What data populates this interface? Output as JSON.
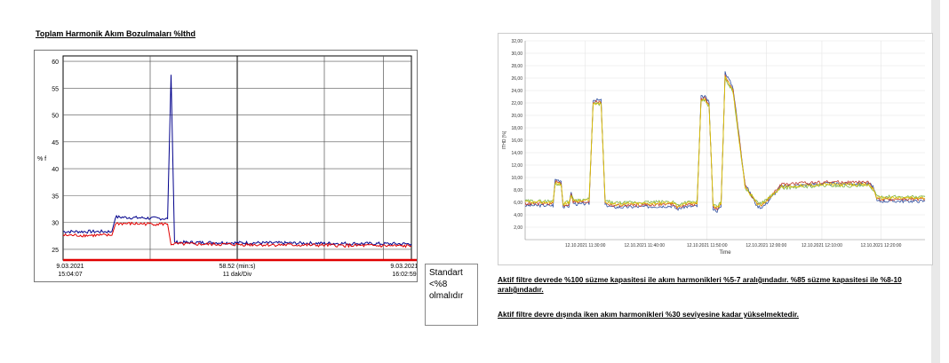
{
  "page": {
    "title": "Toplam Harmonik Akım Bozulmaları %Ithd",
    "note": [
      "Standart",
      "<%8",
      "olmalıdır"
    ],
    "paragraph1": "Aktif filtre devrede %100 süzme kapasitesi ile akım harmonikleri %5-7 aralığındadır. %85 süzme kapasitesi ile %8-10 aralığındadır.",
    "paragraph2": "Aktif filtre devre dışında iken akım harmonikleri %30 seviyesine kadar yükselmektedir."
  },
  "chart_data": [
    {
      "type": "line",
      "title": "Toplam Harmonik Akım Bozulmaları %Ithd",
      "ylabel": "% f",
      "ylim": [
        23,
        61
      ],
      "yticks": [
        25,
        30,
        35,
        40,
        45,
        50,
        55,
        60
      ],
      "x_start": "9.03.2021\n15:04:07",
      "x_end": "9.03.2021\n16:02:59",
      "x_start_date": "9.03.2021",
      "x_start_time": "15:04:07",
      "x_end_date": "9.03.2021",
      "x_end_time": "16:02:59",
      "x_center_label": "58.52 (min:s)",
      "x_div_label": "11 dak/Div",
      "threshold_color": "#e00000",
      "series": [
        {
          "color": "#00008b",
          "x": [
            0,
            14,
            15,
            30,
            31,
            32,
            100
          ],
          "y": [
            28.3,
            28.3,
            31,
            30.7,
            57.5,
            26.3,
            26
          ]
        },
        {
          "color": "#e00000",
          "x": [
            0,
            14,
            15,
            30,
            31,
            100
          ],
          "y": [
            27.6,
            27.6,
            29.8,
            29.7,
            26,
            25.6
          ]
        }
      ]
    },
    {
      "type": "line",
      "ylabel": "ITHD [%]",
      "xlabel": "Time",
      "ylim": [
        0,
        32
      ],
      "yticks": [
        "2,00",
        "4,00",
        "6,00",
        "8,00",
        "10,00",
        "12,00",
        "14,00",
        "16,00",
        "18,00",
        "20,00",
        "22,00",
        "24,00",
        "26,00",
        "28,00",
        "30,00",
        "32,00"
      ],
      "xticks": [
        "12.10.2021 11:30:00",
        "12.10.2021 11:40:00",
        "12.10.2021 11:50:00",
        "12.10.2021 12:00:00",
        "12.10.2021 12:10:00",
        "12.10.2021 12:20:00"
      ],
      "series": [
        {
          "color": "#2f4fa0",
          "x": [
            0,
            7,
            7.5,
            9,
            9.5,
            10,
            11,
            11.5,
            12,
            13,
            16,
            17,
            19,
            20,
            22,
            36,
            37,
            38,
            40,
            43,
            44,
            45,
            46,
            47,
            48,
            49,
            50,
            52,
            55,
            58,
            59,
            60,
            64,
            75,
            86,
            87,
            88,
            100
          ],
          "y": [
            5.5,
            5.5,
            9.7,
            9.5,
            5.2,
            5.3,
            5.4,
            7.8,
            5.9,
            5.7,
            5.8,
            22.5,
            22.4,
            5.6,
            5.2,
            5.4,
            5.4,
            4.9,
            5.3,
            5.4,
            23,
            23,
            22,
            5,
            4.6,
            5.3,
            27,
            24.5,
            9,
            5.4,
            5.2,
            5.6,
            8.6,
            9,
            9,
            8.6,
            6.2,
            6.2
          ]
        },
        {
          "color": "#c0392b",
          "x": [
            0,
            7,
            7.5,
            9,
            9.5,
            10,
            11,
            11.5,
            12,
            13,
            16,
            17,
            19,
            20,
            22,
            36,
            37,
            38,
            40,
            43,
            44,
            45,
            46,
            47,
            48,
            49,
            50,
            52,
            55,
            58,
            59,
            60,
            64,
            75,
            86,
            87,
            88,
            100
          ],
          "y": [
            5.8,
            5.8,
            9.3,
            9.1,
            5.5,
            5.6,
            5.7,
            7.5,
            6.1,
            6,
            6.1,
            22.2,
            22.1,
            5.9,
            5.5,
            5.7,
            5.7,
            5.2,
            5.6,
            5.7,
            22.7,
            22.7,
            21.7,
            5.3,
            4.9,
            5.6,
            26.5,
            24.1,
            8.7,
            5.6,
            5.5,
            5.9,
            8.9,
            9.3,
            9.2,
            8.4,
            6.5,
            6.5
          ]
        },
        {
          "color": "#7cb342",
          "x": [
            0,
            7,
            7.5,
            9,
            9.5,
            10,
            11,
            11.5,
            12,
            13,
            16,
            17,
            19,
            20,
            22,
            36,
            37,
            38,
            40,
            43,
            44,
            45,
            46,
            47,
            48,
            49,
            50,
            52,
            55,
            58,
            59,
            60,
            64,
            75,
            86,
            87,
            88,
            100
          ],
          "y": [
            6.2,
            6.2,
            9,
            8.8,
            5.9,
            6,
            6.1,
            7.2,
            6.5,
            6.4,
            6.5,
            21.9,
            21.8,
            6.3,
            5.9,
            6.1,
            6.1,
            5.6,
            6,
            6.1,
            22.4,
            22.4,
            21.4,
            5.7,
            5.3,
            6,
            26,
            23.7,
            8.4,
            6,
            5.9,
            6.3,
            8.3,
            8.7,
            8.6,
            8.1,
            6.9,
            6.9
          ]
        },
        {
          "color": "#e6c200",
          "x": [
            0,
            7,
            7.5,
            9,
            9.5,
            10,
            11,
            11.5,
            12,
            13,
            16,
            17,
            19,
            20,
            22,
            36,
            37,
            38,
            40,
            43,
            44,
            45,
            46,
            47,
            48,
            49,
            50,
            52,
            55,
            58,
            59,
            60,
            64,
            75,
            86,
            87,
            88,
            100
          ],
          "y": [
            6.0,
            6.0,
            9.1,
            8.9,
            5.7,
            5.8,
            5.9,
            7.3,
            6.3,
            6.2,
            6.3,
            22,
            21.9,
            6.1,
            5.7,
            5.9,
            5.9,
            5.4,
            5.8,
            5.9,
            22.5,
            22.5,
            21.5,
            5.5,
            5.1,
            5.8,
            26.2,
            23.9,
            8.5,
            5.8,
            5.7,
            6.1,
            8.5,
            8.9,
            8.8,
            8.2,
            6.7,
            6.7
          ]
        }
      ]
    }
  ]
}
